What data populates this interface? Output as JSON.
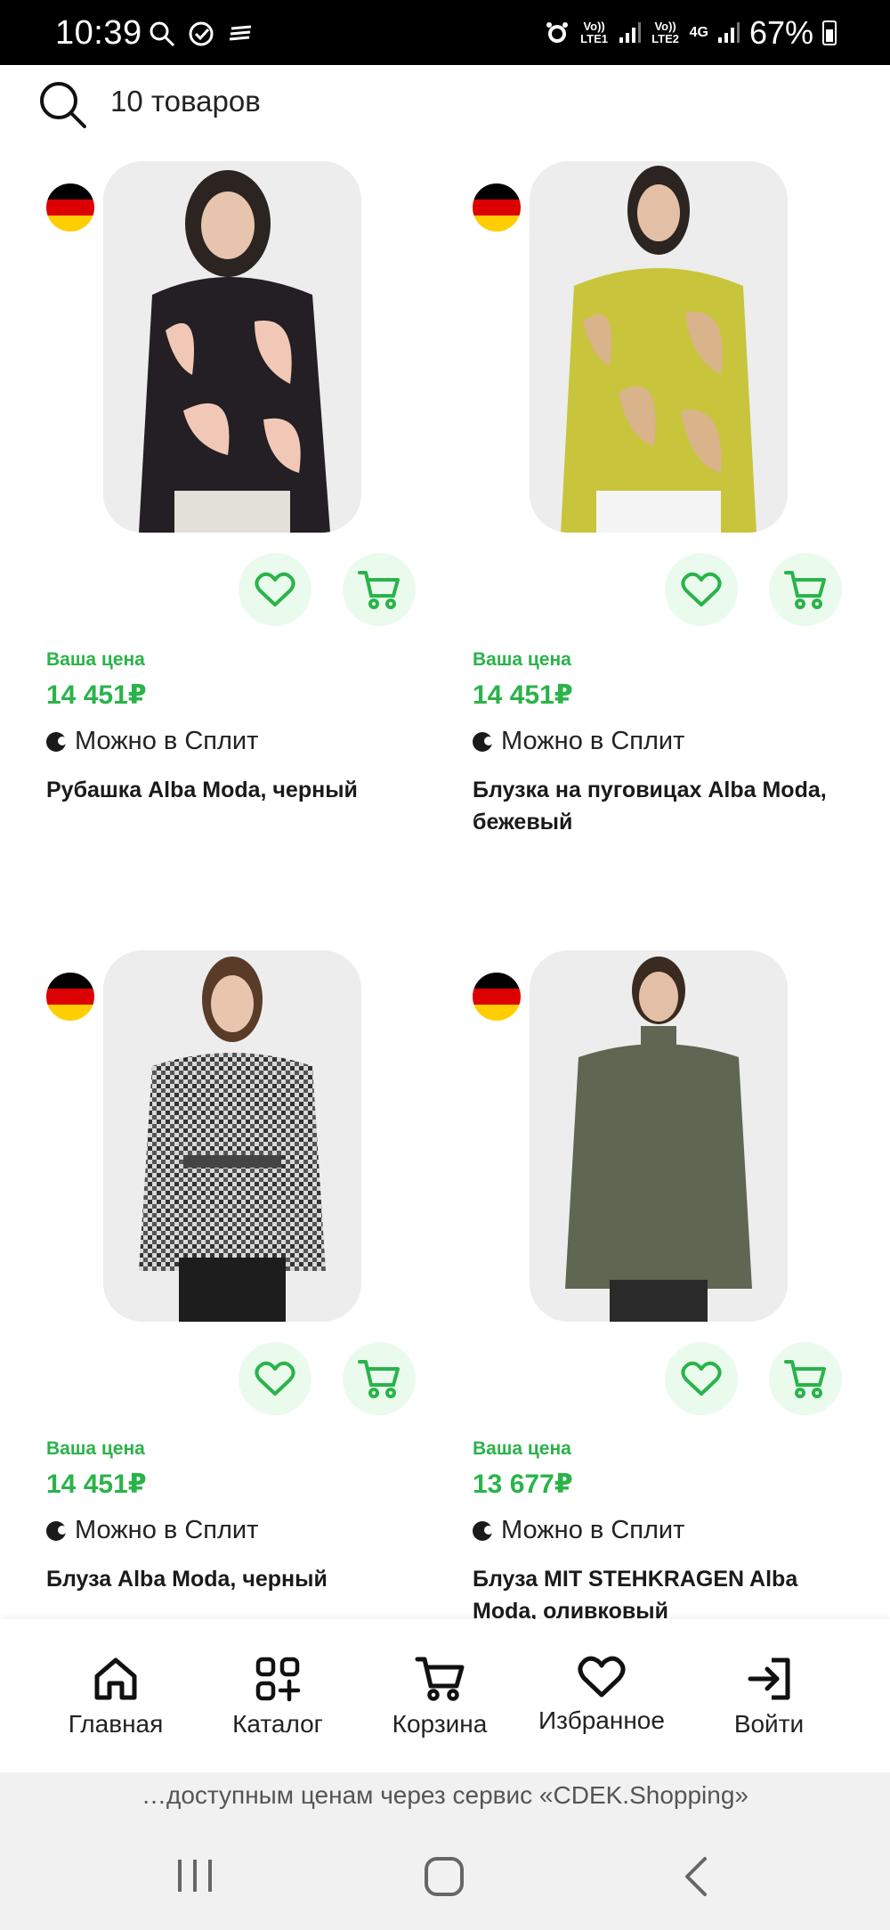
{
  "status_bar": {
    "time": "10:39",
    "sim1": "Vo)) LTE1",
    "sim2": "Vo)) LTE2",
    "net": "4G",
    "battery": "67%"
  },
  "search": {
    "count_label": "10 товаров"
  },
  "products": [
    {
      "your_price_label": "Ваша цена",
      "price": "14 451₽",
      "split_label": "Можно в Сплит",
      "title": "Рубашка Alba Moda, черный"
    },
    {
      "your_price_label": "Ваша цена",
      "price": "14 451₽",
      "split_label": "Можно в Сплит",
      "title": "Блузка на пуговицах Alba Moda, бежевый"
    },
    {
      "your_price_label": "Ваша цена",
      "price": "14 451₽",
      "split_label": "Можно в Сплит",
      "title": "Блуза Alba Moda, черный"
    },
    {
      "your_price_label": "Ваша цена",
      "price": "13 677₽",
      "split_label": "Можно в Сплит",
      "title": "Блуза MIT STEHKRAGEN Alba Moda, оливковый"
    }
  ],
  "nav": {
    "home": "Главная",
    "catalog": "Каталог",
    "cart": "Корзина",
    "favorites": "Избранное",
    "login": "Войти"
  },
  "banner": {
    "text": "…доступным ценам через сервис «CDEK.Shopping»"
  },
  "colors": {
    "accent_green": "#2ab34a",
    "button_bg": "#eafbee"
  }
}
